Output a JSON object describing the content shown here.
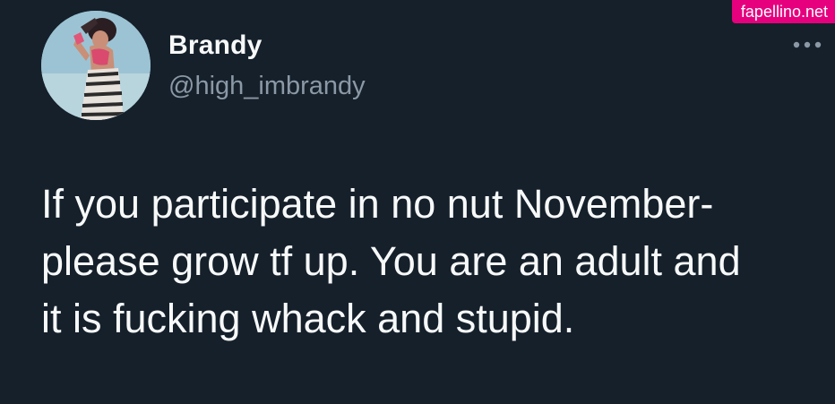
{
  "tweet": {
    "display_name": "Brandy",
    "handle": "@high_imbrandy",
    "text": "If you participate in no nut November-\nplease grow tf up. You are an adult and\nit is fucking whack and stupid.",
    "more_icon": "more-horizontal-icon",
    "avatar_icon": "profile-photo"
  },
  "watermark": {
    "text": "fapellino.net"
  },
  "colors": {
    "background": "#15202b",
    "text_primary": "#f7f9f9",
    "text_secondary": "#8b98a5",
    "link": "#1d9bf0",
    "watermark_bg": "#e6007e"
  }
}
